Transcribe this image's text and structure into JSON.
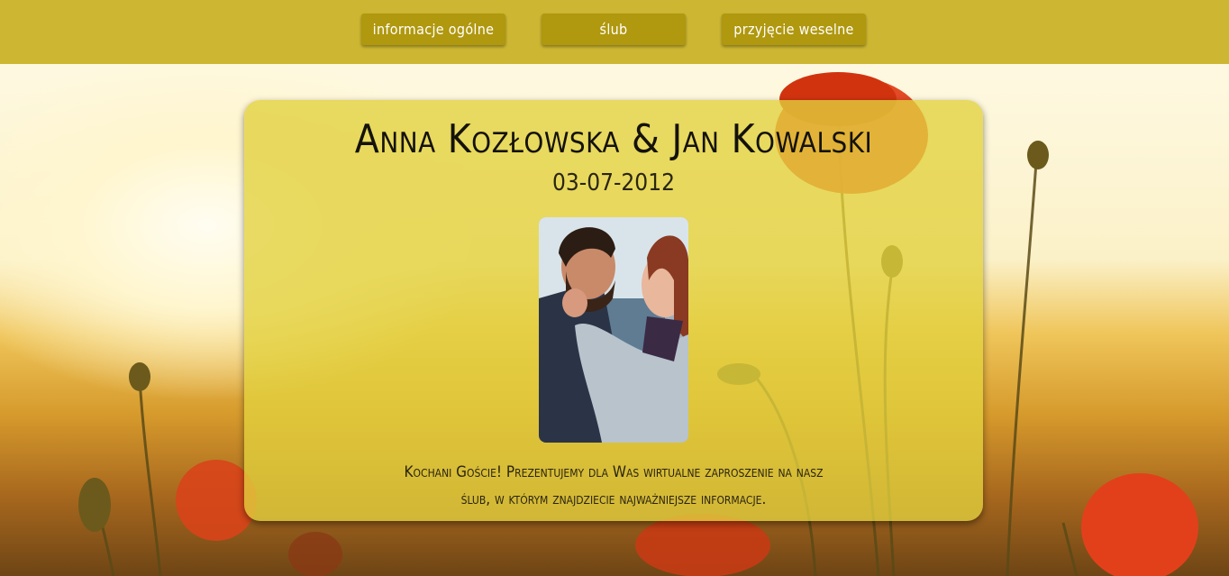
{
  "nav": {
    "items": [
      {
        "label": "informacje ogólne"
      },
      {
        "label": "ślub"
      },
      {
        "label": "przyjęcie weselne"
      }
    ]
  },
  "card": {
    "title": "Anna Kozłowska & Jan Kowalski",
    "date": "03-07-2012",
    "message": "Kochani Goście! Prezentujemy dla Was wirtualne zaproszenie na nasz ślub, w którym znajdziecie najważniejsze informacje."
  },
  "colors": {
    "topbar": "#cdb732",
    "nav_button": "#b0980f",
    "card": "#e2d13e",
    "poppy": "#e2401b"
  }
}
